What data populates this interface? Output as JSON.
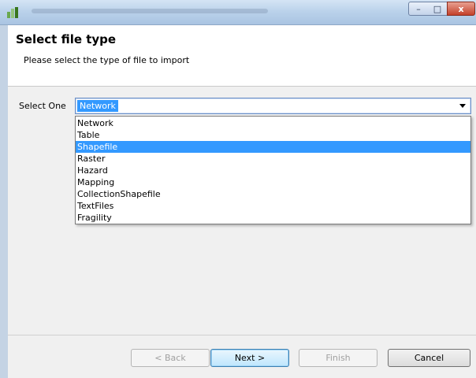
{
  "window": {
    "minimize_glyph": "–",
    "maximize_glyph": "□",
    "close_glyph": "x"
  },
  "header": {
    "title": "Select file type",
    "description": "Please select the type of file to import"
  },
  "form": {
    "select_label": "Select One",
    "selected_value": "Network",
    "options": [
      "Network",
      "Table",
      "Shapefile",
      "Raster",
      "Hazard",
      "Mapping",
      "CollectionShapefile",
      "TextFiles",
      "Fragility"
    ],
    "highlighted_option": "Shapefile"
  },
  "buttons": {
    "back": "< Back",
    "next": "Next >",
    "finish": "Finish",
    "cancel": "Cancel"
  },
  "colors": {
    "selection": "#3399ff"
  }
}
